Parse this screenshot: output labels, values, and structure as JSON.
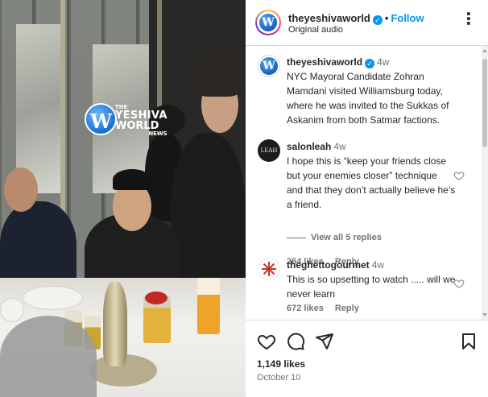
{
  "video": {
    "watermark": {
      "line1": "THE",
      "line2": "YESHIVA",
      "line3": "WORLD",
      "line4": "NEWS"
    }
  },
  "header": {
    "username": "theyeshivaworld",
    "follow_label": "Follow",
    "subtitle": "Original audio",
    "more_icon": "more-options-icon"
  },
  "caption": {
    "username": "theyeshivaworld",
    "time": "4w",
    "text": "NYC Mayoral Candidate Zohran Mamdani visited Williamsburg today, where he was invited to the Sukkas of Askanim from both Satmar factions."
  },
  "comments": [
    {
      "username": "salonleah",
      "avatar_text": "LEAH",
      "time": "4w",
      "text": "I hope this is “keep your friends close but your enemies closer” technique and that they don’t actually believe he’s a friend.",
      "likes": "264 likes",
      "reply_label": "Reply"
    },
    {
      "username": "theghettogourmet",
      "time": "4w",
      "text": "This is so upsetting to watch ..... will we never learn",
      "likes": "672 likes",
      "reply_label": "Reply"
    }
  ],
  "view_replies": "View all 5 replies",
  "footer": {
    "likes": "1,149 likes",
    "date": "October 10"
  },
  "colors": {
    "accent": "#0095f6",
    "text": "#262626",
    "muted": "#737373",
    "border": "#dbdbdb"
  }
}
